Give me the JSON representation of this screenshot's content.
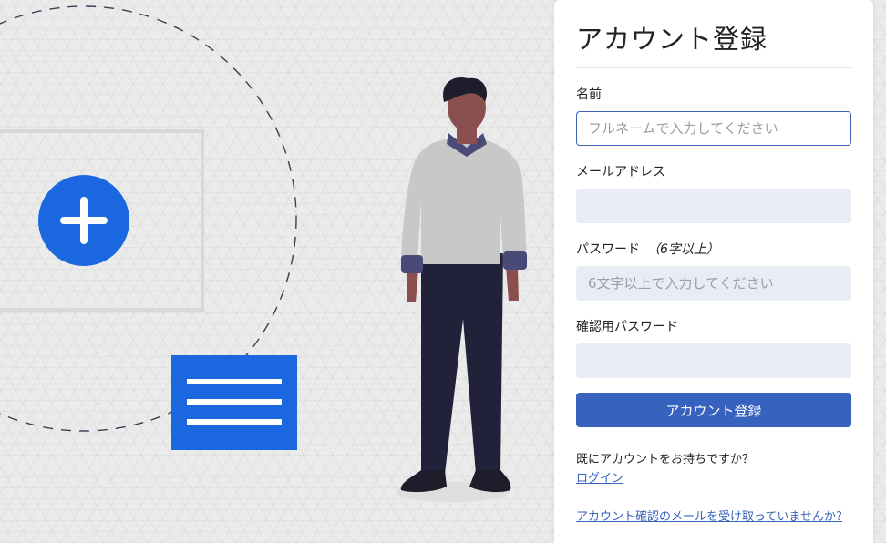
{
  "form": {
    "title": "アカウント登録",
    "name": {
      "label": "名前",
      "placeholder": "フルネームで入力してください",
      "value": ""
    },
    "email": {
      "label": "メールアドレス",
      "placeholder": "",
      "value": ""
    },
    "password": {
      "label": "パスワード",
      "note": "（6字以上）",
      "placeholder": "6文字以上で入力してください",
      "value": ""
    },
    "password_confirm": {
      "label": "確認用パスワード",
      "placeholder": "",
      "value": ""
    },
    "submit_label": "アカウント登録",
    "already_text": "既にアカウントをお持ちですか？",
    "login_link": "ログイン",
    "confirm_email_link": "アカウント確認のメールを受け取っていませんか?"
  },
  "colors": {
    "accent": "#3762bd",
    "illustration_blue": "#1a67e0",
    "input_bg": "#e8ecf4"
  },
  "illustration": {
    "icons": [
      "plus-circle-icon",
      "document-lines-icon",
      "person-figure"
    ]
  }
}
